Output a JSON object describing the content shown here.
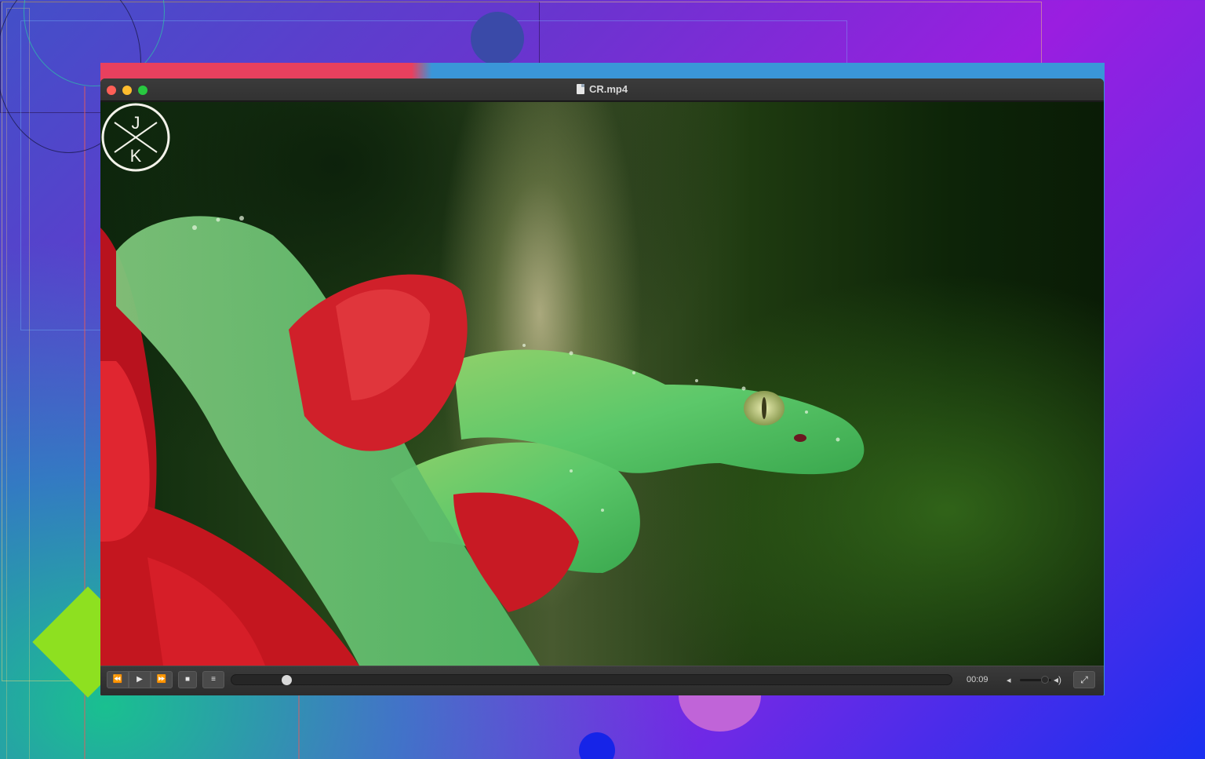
{
  "window": {
    "title": "CR.mp4"
  },
  "video": {
    "watermark_logo": "JK"
  },
  "controls": {
    "rewind_icon": "⏪",
    "play_icon": "▶",
    "fast_forward_icon": "⏩",
    "stop_icon": "■",
    "playlist_icon": "≡",
    "fullscreen_icon": "⤢",
    "time_display": "00:09",
    "volume_low_icon": "🔈",
    "volume_high_icon": "🔊",
    "progress_fraction": 0.04,
    "volume_fraction": 0.9
  },
  "colors": {
    "close": "#fe5f57",
    "minimize": "#febc2e",
    "maximize": "#28c840"
  }
}
